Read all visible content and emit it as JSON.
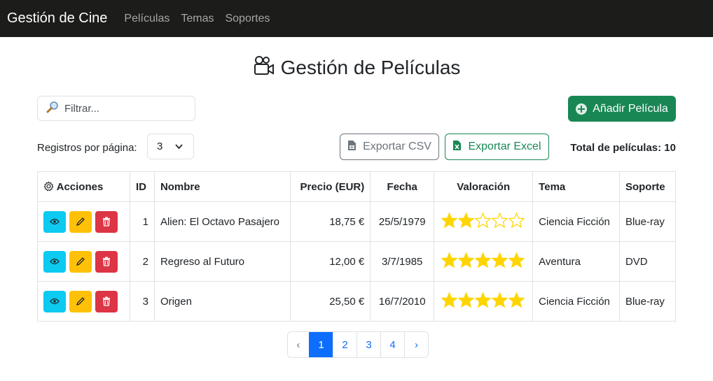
{
  "navbar": {
    "brand": "Gestión de Cine",
    "links": [
      "Películas",
      "Temas",
      "Soportes"
    ]
  },
  "page": {
    "title": "Gestión de Películas",
    "title_icon": "video-camera-icon"
  },
  "filter": {
    "placeholder": "Filtrar...",
    "value": "",
    "icon": "magnifier-icon"
  },
  "add_button": {
    "label": "Añadir Película",
    "icon": "plus-circle-icon"
  },
  "records": {
    "label": "Registros por página:",
    "selected": "3"
  },
  "export": {
    "csv_label": "Exportar CSV",
    "excel_label": "Exportar Excel"
  },
  "total": "Total de películas: 10",
  "table": {
    "headers": [
      "Acciones",
      "ID",
      "Nombre",
      "Precio (EUR)",
      "Fecha",
      "Valoración",
      "Tema",
      "Soporte"
    ],
    "rows": [
      {
        "id": "1",
        "nombre": "Alien: El Octavo Pasajero",
        "precio": "18,75 €",
        "fecha": "25/5/1979",
        "valoracion": 2,
        "tema": "Ciencia Ficción",
        "soporte": "Blue-ray"
      },
      {
        "id": "2",
        "nombre": "Regreso al Futuro",
        "precio": "12,00 €",
        "fecha": "3/7/1985",
        "valoracion": 5,
        "tema": "Aventura",
        "soporte": "DVD"
      },
      {
        "id": "3",
        "nombre": "Origen",
        "precio": "25,50 €",
        "fecha": "16/7/2010",
        "valoracion": 5,
        "tema": "Ciencia Ficción",
        "soporte": "Blue-ray"
      }
    ]
  },
  "pagination": {
    "prev": "‹",
    "pages": [
      "1",
      "2",
      "3",
      "4"
    ],
    "next": "›",
    "active": "1"
  },
  "colors": {
    "navbar": "#1c1d1b",
    "success": "#198754",
    "primary": "#0d6efd",
    "info": "#0dcaf0",
    "warning": "#ffc107",
    "danger": "#dc3545",
    "star": "#ffd500"
  }
}
